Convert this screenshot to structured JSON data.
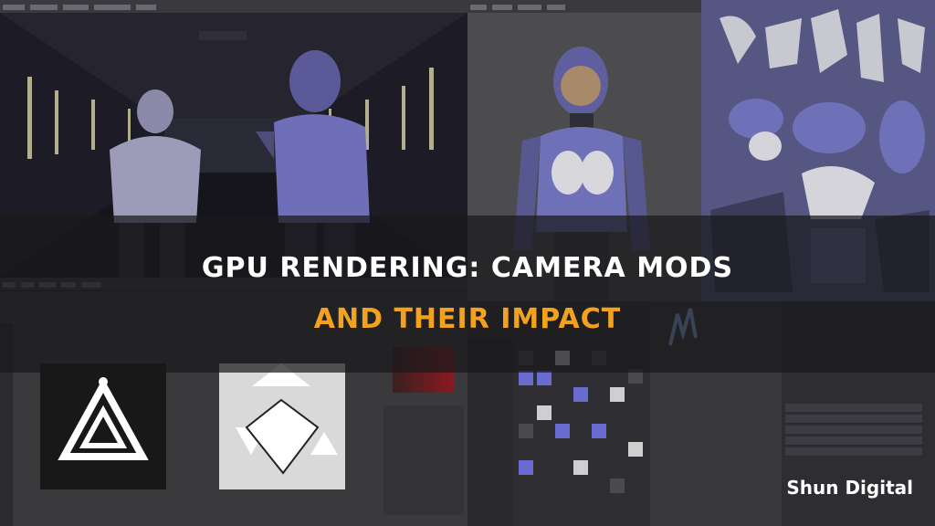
{
  "headline": {
    "line1": "GPU RENDERING: CAMERA MODS",
    "line2": "AND THEIR IMPACT"
  },
  "brand": "Shun Digital",
  "colors": {
    "accent": "#f3a21f",
    "suit_purple": "#6e6fb8",
    "ui_dark": "#2b2b2f"
  }
}
